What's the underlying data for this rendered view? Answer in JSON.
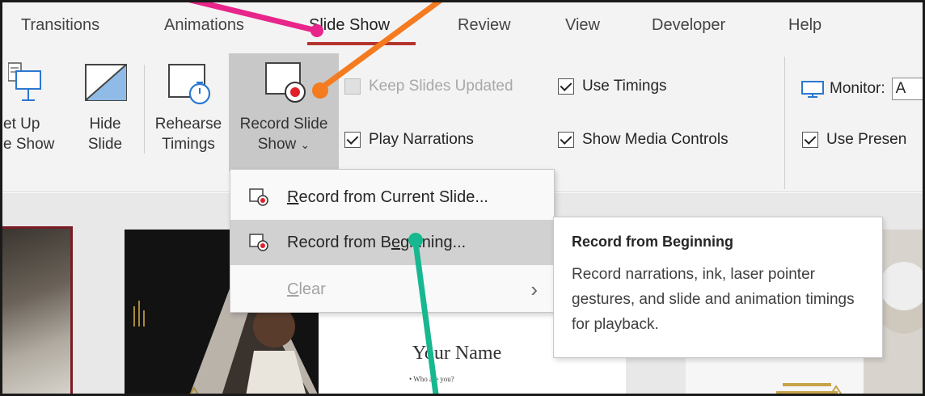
{
  "tabs": {
    "transitions": "Transitions",
    "animations": "Animations",
    "slide_show": "Slide Show",
    "review": "Review",
    "view": "View",
    "developer": "Developer",
    "help": "Help"
  },
  "ribbon": {
    "set_up_line1": "et Up",
    "set_up_line2": "e Show",
    "hide_line1": "Hide",
    "hide_line2": "Slide",
    "rehearse_line1": "Rehearse",
    "rehearse_line2": "Timings",
    "record_line1": "Record Slide",
    "record_line2": "Show",
    "record_chevron": "⌄",
    "keep_updated": "Keep Slides Updated",
    "use_timings": "Use Timings",
    "play_narrations": "Play Narrations",
    "show_media_controls": "Show Media Controls",
    "monitor_label": "Monitor:",
    "monitor_value": "A",
    "use_presenter": "Use Presen",
    "keep_updated_checked": false,
    "use_timings_checked": true,
    "play_narrations_checked": true,
    "show_media_controls_checked": true,
    "use_presenter_checked": true
  },
  "menu": {
    "item_current_underlined": "R",
    "item_current_rest": "ecord from Current Slide...",
    "item_beginning_pre": "Record from B",
    "item_beginning_underlined": "e",
    "item_beginning_post": "ginning...",
    "item_clear_underlined": "C",
    "item_clear_rest": "lear",
    "clear_chevron": "›"
  },
  "tooltip": {
    "title": "Record from Beginning",
    "body": "Record narrations, ink, laser pointer gestures, and slide and animation timings for playback."
  },
  "slide": {
    "name": "Your Name",
    "subtitle": "Who are you?"
  },
  "colors": {
    "tab_underline": "#b3342c",
    "arrow_pink": "#e8258a",
    "arrow_orange": "#f47b20",
    "arrow_teal": "#17b890",
    "record_dot": "#e0202a",
    "monitor_icon": "#2b78d0"
  }
}
